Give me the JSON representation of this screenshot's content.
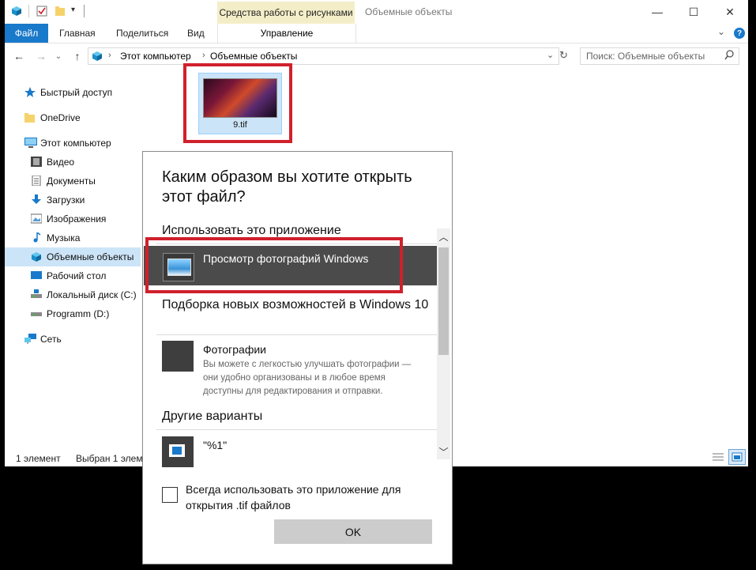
{
  "window": {
    "ribbon_context_tab": "Средства работы с рисунками",
    "title": "Объемные объекты",
    "tabs": [
      "Файл",
      "Главная",
      "Поделиться",
      "Вид"
    ],
    "manage_tab": "Управление",
    "help": "?",
    "accent": "#1979ca"
  },
  "address": {
    "path": [
      "Этот компьютер",
      "Объемные объекты"
    ],
    "search_placeholder": "Поиск: Объемные объекты"
  },
  "sidebar": {
    "items": [
      {
        "label": "Быстрый доступ",
        "icon": "star-icon"
      },
      {
        "label": "OneDrive",
        "icon": "folder-icon"
      },
      {
        "label": "Этот компьютер",
        "icon": "computer-icon"
      },
      {
        "label": "Видео",
        "icon": "video-icon"
      },
      {
        "label": "Документы",
        "icon": "documents-icon"
      },
      {
        "label": "Загрузки",
        "icon": "download-icon"
      },
      {
        "label": "Изображения",
        "icon": "pictures-icon"
      },
      {
        "label": "Музыка",
        "icon": "music-icon"
      },
      {
        "label": "Объемные объекты",
        "icon": "3d-objects-icon"
      },
      {
        "label": "Рабочий стол",
        "icon": "desktop-icon"
      },
      {
        "label": "Локальный диск (C:)",
        "icon": "drive-icon"
      },
      {
        "label": "Programm (D:)",
        "icon": "drive-icon"
      },
      {
        "label": "Сеть",
        "icon": "network-icon"
      }
    ]
  },
  "file": {
    "name": "9.tif"
  },
  "status": {
    "count": "1 элемент",
    "selected": "Выбран 1 элем"
  },
  "dialog": {
    "title": "Каким образом вы хотите открыть этот файл?",
    "section_use": "Использовать это приложение",
    "app_selected": "Просмотр фотографий Windows",
    "section_new": "Подборка новых возможностей в Windows 10",
    "photos_name": "Фотографии",
    "photos_desc": "Вы можете с легкостью улучшать фотографии — они удобно организованы и в любое время доступны для редактирования и отправки.",
    "section_other": "Другие варианты",
    "other_name": "\"%1\"",
    "checkbox_label": "Всегда использовать это приложение для открытия .tif файлов",
    "ok": "OK"
  }
}
